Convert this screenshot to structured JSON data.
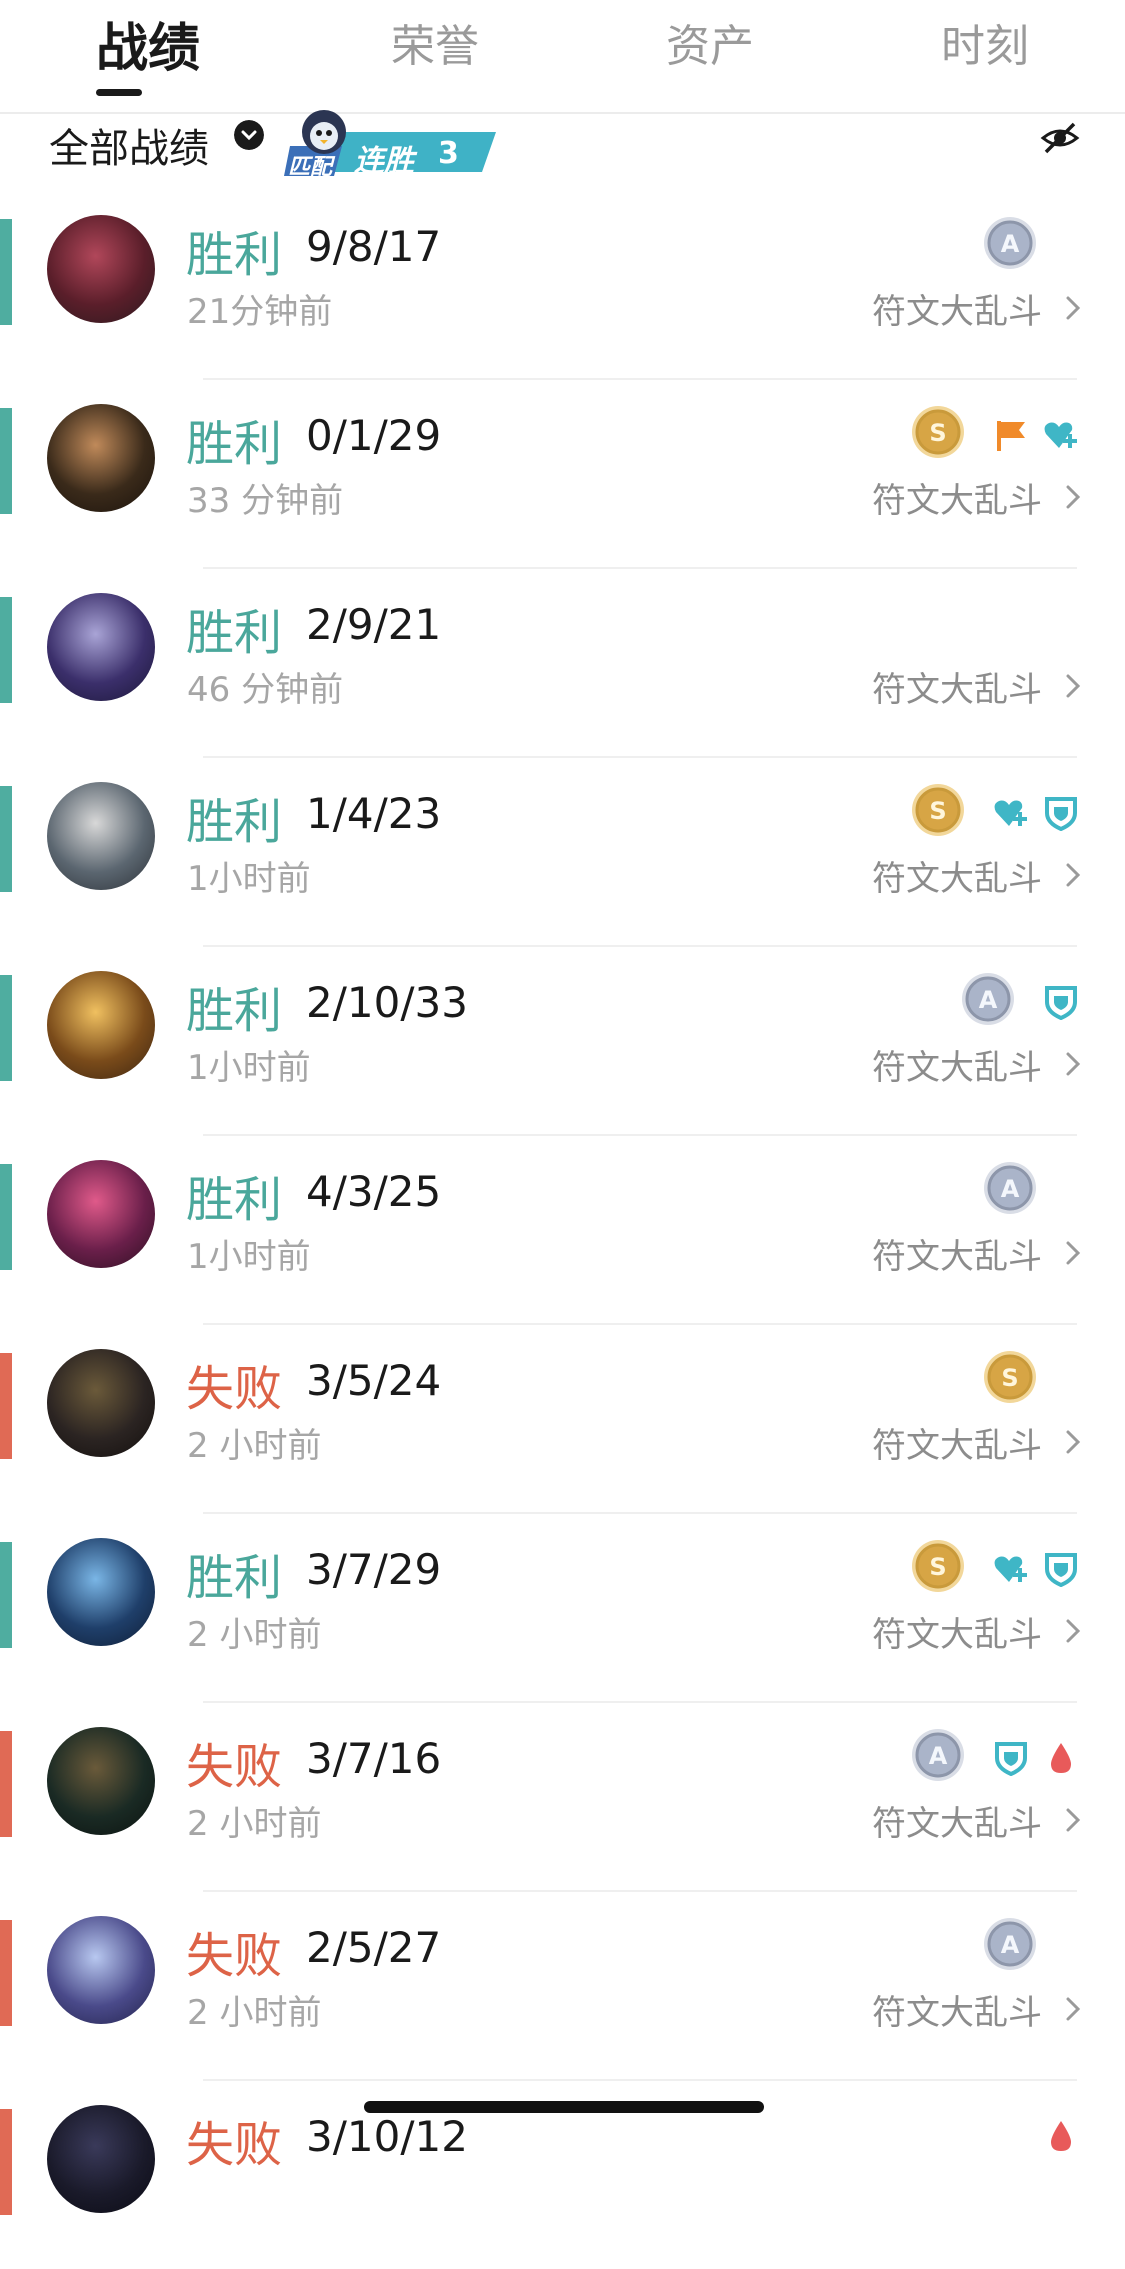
{
  "tabs": [
    {
      "label": "战绩",
      "active": true
    },
    {
      "label": "荣誉",
      "active": false
    },
    {
      "label": "资产",
      "active": false
    },
    {
      "label": "时刻",
      "active": false
    }
  ],
  "filter": {
    "label": "全部战绩",
    "streak_badge": {
      "queue": "匹配",
      "text": "连胜",
      "count": "3"
    }
  },
  "colors": {
    "win": "#4aa79b",
    "lose": "#dd6347",
    "text": "#1a1a1a",
    "muted": "#a6a6a6"
  },
  "matches": [
    {
      "result": "胜利",
      "outcome": "win",
      "kda": "9/8/17",
      "time": "21分钟前",
      "mode": "符文大乱斗",
      "badges": [
        "A"
      ],
      "icons": []
    },
    {
      "result": "胜利",
      "outcome": "win",
      "kda": "0/1/29",
      "time": "33 分钟前",
      "mode": "符文大乱斗",
      "badges": [
        "S"
      ],
      "icons": [
        "flag-icon",
        "heal-icon"
      ]
    },
    {
      "result": "胜利",
      "outcome": "win",
      "kda": "2/9/21",
      "time": "46 分钟前",
      "mode": "符文大乱斗",
      "badges": [],
      "icons": []
    },
    {
      "result": "胜利",
      "outcome": "win",
      "kda": "1/4/23",
      "time": "1小时前",
      "mode": "符文大乱斗",
      "badges": [
        "S"
      ],
      "icons": [
        "heal-icon",
        "shield-icon"
      ]
    },
    {
      "result": "胜利",
      "outcome": "win",
      "kda": "2/10/33",
      "time": "1小时前",
      "mode": "符文大乱斗",
      "badges": [
        "A"
      ],
      "icons": [
        "shield-icon"
      ]
    },
    {
      "result": "胜利",
      "outcome": "win",
      "kda": "4/3/25",
      "time": "1小时前",
      "mode": "符文大乱斗",
      "badges": [
        "A"
      ],
      "icons": []
    },
    {
      "result": "失败",
      "outcome": "lose",
      "kda": "3/5/24",
      "time": "2 小时前",
      "mode": "符文大乱斗",
      "badges": [
        "S"
      ],
      "icons": []
    },
    {
      "result": "胜利",
      "outcome": "win",
      "kda": "3/7/29",
      "time": "2 小时前",
      "mode": "符文大乱斗",
      "badges": [
        "S"
      ],
      "icons": [
        "heal-icon",
        "shield-icon"
      ]
    },
    {
      "result": "失败",
      "outcome": "lose",
      "kda": "3/7/16",
      "time": "2 小时前",
      "mode": "符文大乱斗",
      "badges": [
        "A"
      ],
      "icons": [
        "shield-icon",
        "blood-drop-icon"
      ]
    },
    {
      "result": "失败",
      "outcome": "lose",
      "kda": "2/5/27",
      "time": "2 小时前",
      "mode": "符文大乱斗",
      "badges": [
        "A"
      ],
      "icons": []
    },
    {
      "result": "失败",
      "outcome": "lose",
      "kda": "3/10/12",
      "time": "",
      "mode": "",
      "badges": [],
      "icons": [
        "blood-drop-icon"
      ]
    }
  ]
}
